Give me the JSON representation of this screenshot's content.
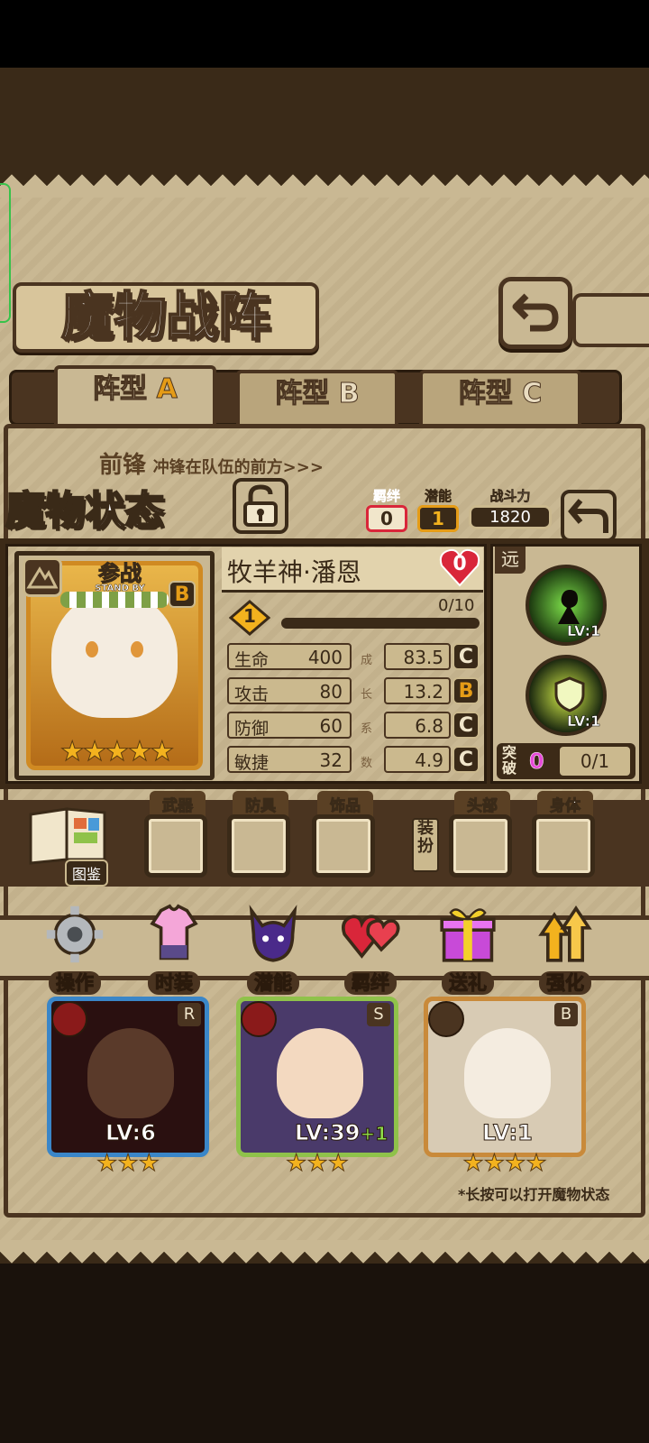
{
  "header": {
    "title": "魔物战阵",
    "back_icon": "return-arrow-icon"
  },
  "formation_tabs": [
    {
      "label": "阵型",
      "letter": "A"
    },
    {
      "label": "阵型",
      "letter": "B"
    },
    {
      "label": "阵型",
      "letter": "C"
    }
  ],
  "vanguard": {
    "label": "前锋",
    "desc": "冲锋在队伍的前方>>>"
  },
  "status": {
    "title": "魔物状态",
    "lock_icon": "padlock-icon",
    "bond_label": "羁绊",
    "bond_value": "0",
    "potential_label": "潜能",
    "potential_value": "1",
    "power_label": "战斗力",
    "power_value": "1820"
  },
  "monster": {
    "standby_label": "参战",
    "standby_sub": "STAND BY",
    "rank": "B",
    "name": "牧羊神·潘恩",
    "heart_count": "0",
    "level": "1",
    "exp_text": "0/10",
    "exp_fraction": 0.0,
    "stars": 5,
    "range_label": "远",
    "stats": [
      {
        "label": "生命",
        "value": "400",
        "growth": "83.5",
        "grade": "C"
      },
      {
        "label": "攻击",
        "value": "80",
        "growth": "13.2",
        "grade": "B"
      },
      {
        "label": "防御",
        "value": "60",
        "growth": "6.8",
        "grade": "C"
      },
      {
        "label": "敏捷",
        "value": "32",
        "growth": "4.9",
        "grade": "C"
      }
    ],
    "growth_label": [
      "成",
      "长",
      "系",
      "数"
    ],
    "skills": [
      {
        "level": "LV:1"
      },
      {
        "level": "LV:1"
      }
    ],
    "breakthrough_label": "突破",
    "breakthrough_count": "0",
    "breakthrough_progress": "0/1"
  },
  "equipment": {
    "codex_label": "图鉴",
    "slots": [
      {
        "label": "武器"
      },
      {
        "label": "防具"
      },
      {
        "label": "饰品"
      },
      {
        "label": "头部"
      },
      {
        "label": "身体"
      }
    ],
    "dress_label": "装扮"
  },
  "menu": [
    {
      "label": "操作",
      "icon": "gear-icon"
    },
    {
      "label": "时装",
      "icon": "dress-icon"
    },
    {
      "label": "潜能",
      "icon": "demon-icon"
    },
    {
      "label": "羁绊",
      "icon": "hearts-icon"
    },
    {
      "label": "送礼",
      "icon": "gift-icon"
    },
    {
      "label": "强化",
      "icon": "upgrade-arrows-icon"
    }
  ],
  "roster": [
    {
      "rank": "R",
      "level": "LV:6",
      "bonus": "",
      "stars": 3
    },
    {
      "rank": "S",
      "level": "LV:39",
      "bonus": "+1",
      "stars": 3
    },
    {
      "rank": "B",
      "level": "LV:1",
      "bonus": "",
      "stars": 4
    }
  ],
  "hint": "*长按可以打开魔物状态",
  "colors": {
    "gold": "#f3b21e",
    "grade_b": "#e59c17",
    "heart": "#d9263a",
    "panel_dark": "#3c2a17"
  }
}
